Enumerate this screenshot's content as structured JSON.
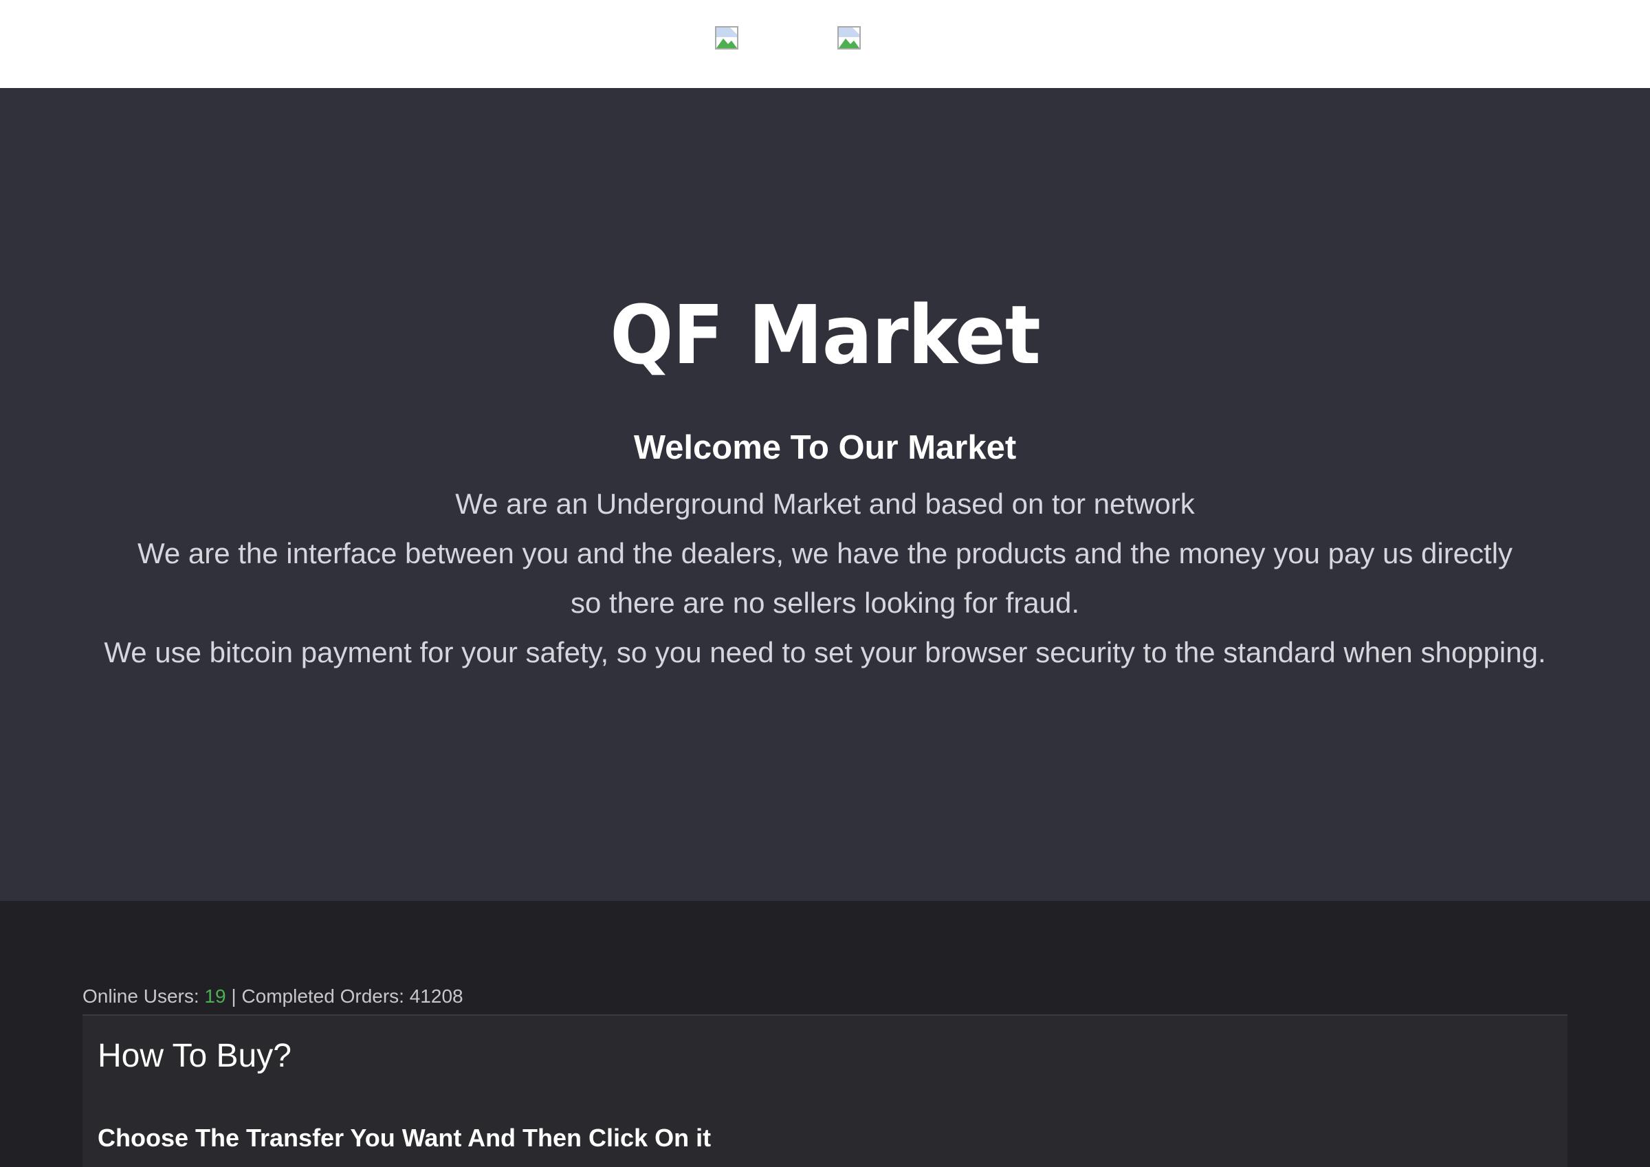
{
  "header": {
    "images": [
      {
        "icon": "broken-image-icon"
      },
      {
        "icon": "broken-image-icon"
      }
    ]
  },
  "hero": {
    "title": "QF Market",
    "subtitle": "Welcome To Our Market",
    "lines": [
      "We are an Underground Market and based on tor network",
      "We are the interface between you and the dealers, we have the products and the money you pay us directly",
      "so there are no sellers looking for fraud.",
      "We use bitcoin payment for your safety, so you need to set your browser security to the standard when shopping."
    ]
  },
  "stats": {
    "online_label": "Online Users: ",
    "online_value": "19",
    "separator": " | ",
    "orders_label": "Completed Orders: ",
    "orders_value": "41208"
  },
  "how_to_buy": {
    "title": "How To Buy?",
    "step": "Choose The Transfer You Want And Then Click On it"
  },
  "colors": {
    "hero_bg": "#30313a",
    "page_bg": "#212125",
    "panel_bg": "#29292e",
    "online_value": "#4caf50"
  }
}
